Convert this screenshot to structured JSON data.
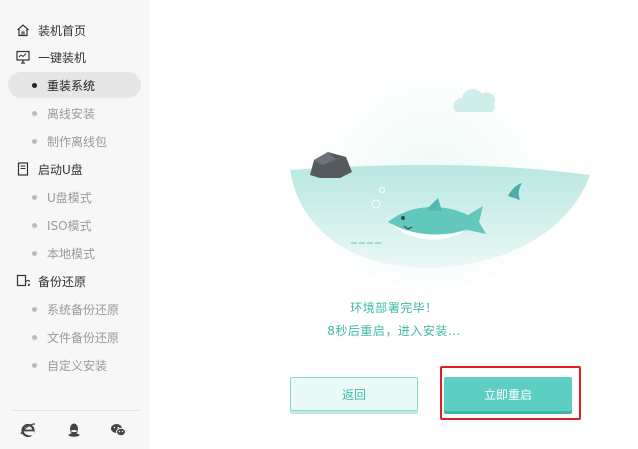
{
  "sidebar": {
    "groups": [
      {
        "label": "装机首页",
        "icon": "home-icon"
      },
      {
        "label": "一键装机",
        "icon": "monitor-icon",
        "items": [
          {
            "label": "重装系统",
            "active": true
          },
          {
            "label": "离线安装"
          },
          {
            "label": "制作离线包"
          }
        ]
      },
      {
        "label": "启动U盘",
        "icon": "usb-drive-icon",
        "items": [
          {
            "label": "U盘模式"
          },
          {
            "label": "ISO模式"
          },
          {
            "label": "本地模式"
          }
        ]
      },
      {
        "label": "备份还原",
        "icon": "backup-icon",
        "items": [
          {
            "label": "系统备份还原"
          },
          {
            "label": "文件备份还原"
          },
          {
            "label": "自定义安装"
          }
        ]
      }
    ],
    "footer_icons": [
      "ie-browser-icon",
      "qq-icon",
      "wechat-icon"
    ]
  },
  "main": {
    "illustration": "shark-sea-rock-cloud",
    "status_line1": "环境部署完毕！",
    "status_line2": "8秒后重启，进入安装...",
    "back_label": "返回",
    "restart_label": "立即重启"
  },
  "colors": {
    "accent": "#5dcec2",
    "accent_text": "#3fb8a8",
    "highlight_border": "#e02020",
    "sidebar_bg": "#f7f7f7"
  }
}
